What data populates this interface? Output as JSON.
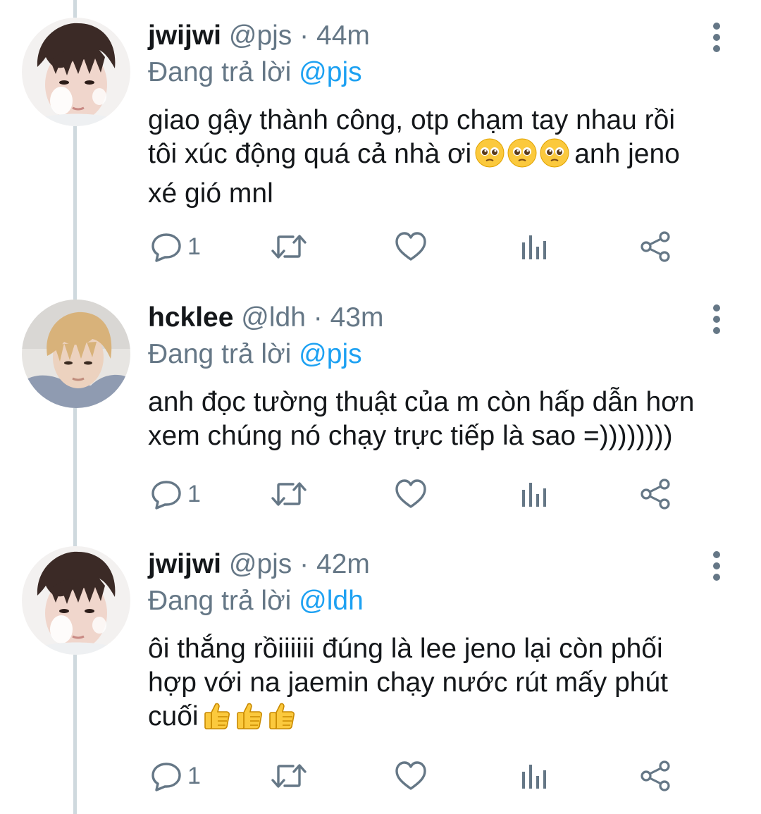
{
  "colors": {
    "text": "#14171a",
    "secondary": "#657786",
    "link": "#1da1f2",
    "thread_line": "#cfd9de"
  },
  "labels": {
    "separator": "·",
    "replying_to": "Đang trả lời"
  },
  "tweets": [
    {
      "author": "jwijwi",
      "handle": "@pjs",
      "time": "44m",
      "reply_to": "@pjs",
      "lines": [
        "giao gậy thành công, otp chạm tay nhau rồi",
        "tôi xúc động quá cả nhà ơi",
        "anh jeno",
        "xé gió mnl"
      ],
      "emojis": [
        "pleading-face",
        "pleading-face",
        "pleading-face"
      ],
      "reply_count": "1",
      "avatar": "avatar-jwijwi"
    },
    {
      "author": "hcklee",
      "handle": "@ldh",
      "time": "43m",
      "reply_to": "@pjs",
      "lines": [
        "anh đọc tường thuật của m còn hấp dẫn hơn",
        "xem chúng nó chạy trực tiếp là sao =))))))))"
      ],
      "reply_count": "1",
      "avatar": "avatar-hcklee"
    },
    {
      "author": "jwijwi",
      "handle": "@pjs",
      "time": "42m",
      "reply_to": "@ldh",
      "lines": [
        "ôi thắng rồiiiiii đúng là lee jeno lại còn phối",
        "hợp với na jaemin chạy nước rút mấy phút",
        "cuối"
      ],
      "emojis": [
        "thumbs-up",
        "thumbs-up",
        "thumbs-up"
      ],
      "reply_count": "1",
      "avatar": "avatar-jwijwi"
    }
  ],
  "icons": {
    "reply": "reply-icon",
    "retweet": "retweet-icon",
    "like": "heart-icon",
    "analytics": "analytics-icon",
    "share": "share-icon",
    "more": "more-vertical-icon"
  }
}
